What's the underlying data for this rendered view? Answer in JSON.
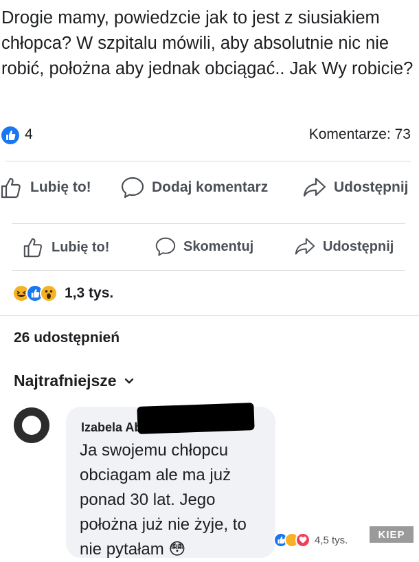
{
  "post": {
    "text": "Drogie mamy, powiedzcie jak to jest z siusiakiem chłopca? W szpitalu mówili, aby absolutnie nic nie robić, położna aby jednak obciągać.. Jak Wy robicie?",
    "likes": "4",
    "comments": "Komentarze: 73"
  },
  "actions_1": {
    "like": "Lubię to!",
    "comment": "Dodaj komentarz",
    "share": "Udostępnij"
  },
  "actions_2": {
    "like": "Lubię to!",
    "comment": "Skomentuj",
    "share": "Udostępnij"
  },
  "reactions": {
    "count": "1,3 tys.",
    "icons": [
      "haha-icon",
      "like-icon",
      "wow-icon"
    ]
  },
  "shares": "26 udostępnień",
  "sort": {
    "label": "Najtrafniejsze"
  },
  "comment": {
    "author": "Izabela Abramowicz",
    "text": "Ja swojemu chłopcu obciagam ale ma już ponad 30 lat. Jego położna już nie żyje, to nie pytałam 😳",
    "reaction_count": "4,5 tys."
  },
  "watermark": "KIEP",
  "colors": {
    "like_blue": "#1877f2",
    "text": "#1c1e21",
    "muted": "#4b4f56",
    "divider": "#d9dbde",
    "bubble": "#f0f2f5",
    "reaction_yellow": "#f7b125",
    "heart_red": "#f33e58"
  }
}
